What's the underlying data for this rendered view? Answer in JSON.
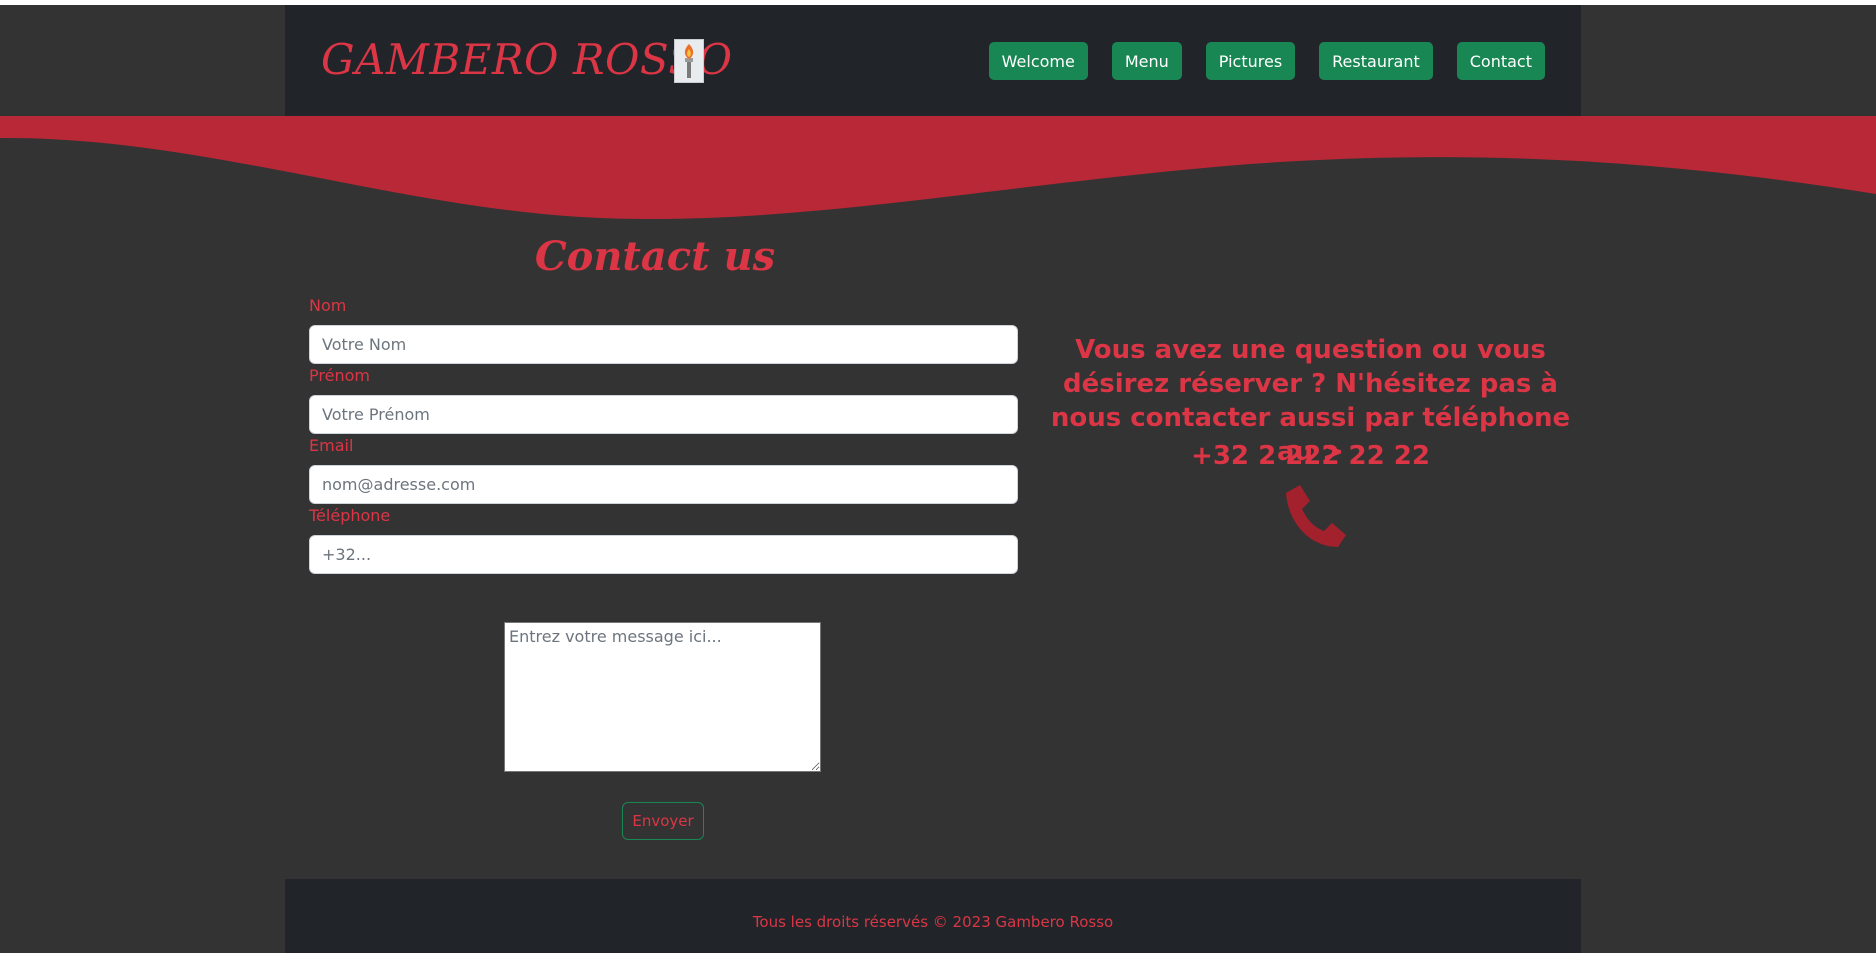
{
  "header": {
    "brand": "GAMBERO ROSSO",
    "nav": [
      "Welcome",
      "Menu",
      "Pictures",
      "Restaurant",
      "Contact"
    ]
  },
  "contact": {
    "title": "Contact us",
    "fields": {
      "nom": {
        "label": "Nom",
        "placeholder": "Votre Nom"
      },
      "prenom": {
        "label": "Prénom",
        "placeholder": "Votre Prénom"
      },
      "email": {
        "label": "Email",
        "placeholder": "nom@adresse.com"
      },
      "telephone": {
        "label": "Téléphone",
        "placeholder": "+32..."
      }
    },
    "message_placeholder": "Entrez votre message ici...",
    "send_label": "Envoyer"
  },
  "info": {
    "text": "Vous avez une question ou vous désirez réserver ? N'hésitez pas à nous contacter aussi par téléphone au >",
    "phone": "+32 2 222 22 22"
  },
  "footer": {
    "text": "Tous les droits réservés © 2023 Gambero Rosso"
  },
  "colors": {
    "accent": "#dc3545",
    "button": "#198754",
    "background": "#333333",
    "header_bg": "#212529",
    "wave": "#b82836"
  },
  "icons": {
    "logo": "torch-icon",
    "phone": "phone-icon"
  }
}
